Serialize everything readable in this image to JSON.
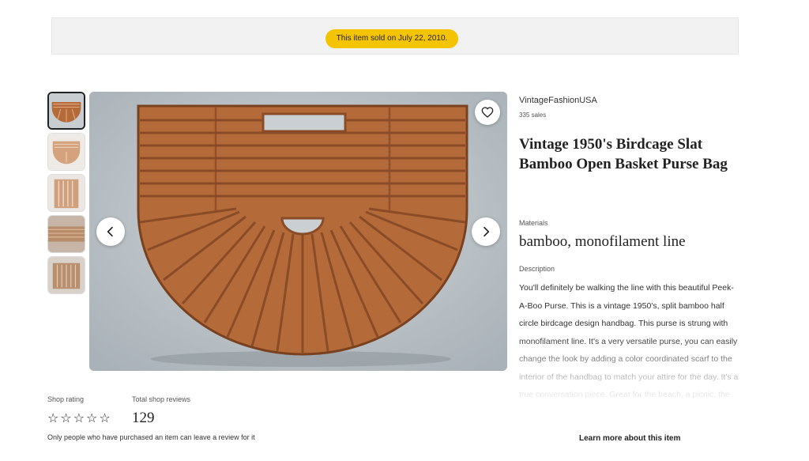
{
  "banner": {
    "sold_text": "This item sold on July 22, 2010."
  },
  "shop": {
    "name": "VintageFashionUSA",
    "sales": "335 sales"
  },
  "listing": {
    "title": "Vintage 1950's Birdcage Slat Bamboo Open Basket Purse Bag",
    "materials_label": "Materials",
    "materials": "bamboo, monofilament line",
    "description_label": "Description",
    "description": "You'll definitely be walking the line with this beautiful Peek-A-Boo Purse. This is a vintage 1950's, split bamboo half circle birdcage design handbag. This purse is strung with monofilament line. It's a very versatile purse, you can easily change the look by adding a color coordinated scarf to the interior of the handbag to match your attire for the day. It's a true conversation piece. Great for the beach, a picnic, the",
    "learn_more": "Learn more about this item"
  },
  "reviews": {
    "rating_label": "Shop rating",
    "total_label": "Total shop reviews",
    "total": "129",
    "stars": 0,
    "note": "Only people who have purchased an item can leave a review for it"
  },
  "gallery": {
    "thumbnail_count": 5,
    "selected_index": 0
  },
  "colors": {
    "banner_pill": "#f5c400",
    "bamboo": "#b56a3a",
    "backdrop": "#b7bfc4"
  },
  "icons": {
    "favorite": "heart-icon",
    "previous": "chevron-left-icon",
    "next": "chevron-right-icon",
    "star": "star-outline-icon"
  }
}
